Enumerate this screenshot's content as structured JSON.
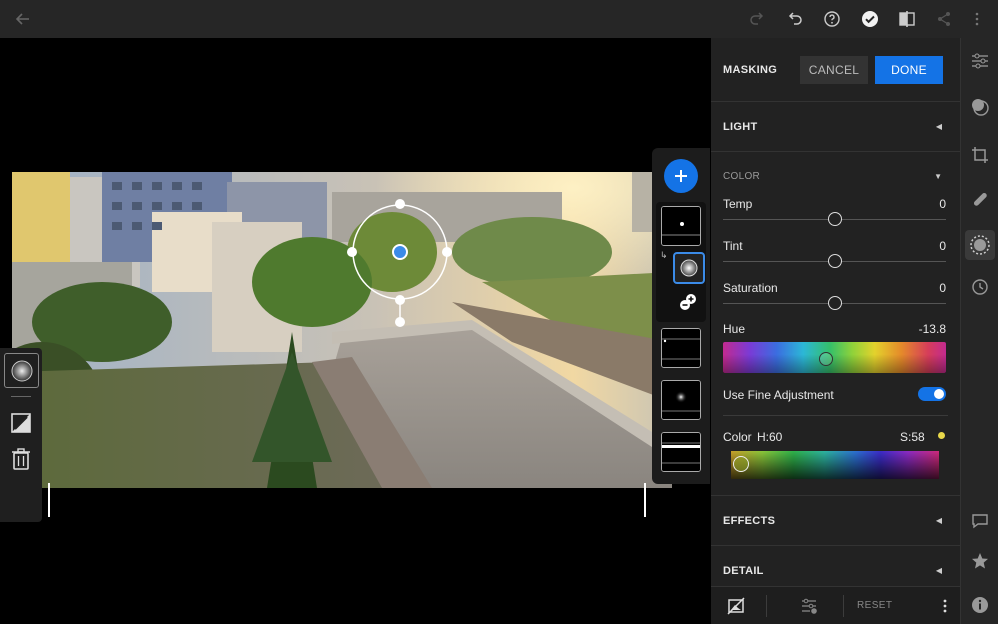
{
  "topbar": {
    "icons": [
      "back-arrow-icon",
      "redo-icon",
      "undo-icon",
      "help-icon",
      "check-icon",
      "compare-icon",
      "share-icon",
      "more-vertical-icon"
    ]
  },
  "panel": {
    "title": "MASKING",
    "cancel_label": "CANCEL",
    "done_label": "DONE",
    "light_label": "LIGHT",
    "color_label": "COLOR",
    "temp": {
      "label": "Temp",
      "value": "0",
      "level": 0.5
    },
    "tint": {
      "label": "Tint",
      "value": "0",
      "level": 0.5
    },
    "saturation": {
      "label": "Saturation",
      "value": "0",
      "level": 0.5
    },
    "hue": {
      "label": "Hue",
      "value": "-13.8",
      "level": 0.46
    },
    "fine_adjust_label": "Use Fine Adjustment",
    "fine_adjust_on": true,
    "color_picker": {
      "label": "Color",
      "h_text": "H:60",
      "s_text": "S:58",
      "swatch": "#e8d84a"
    },
    "effects_label": "EFFECTS",
    "detail_label": "DETAIL",
    "reset_label": "RESET"
  },
  "colors": {
    "accent": "#1473e6",
    "panel_bg": "#222222",
    "toolbar_bg": "#262626"
  }
}
